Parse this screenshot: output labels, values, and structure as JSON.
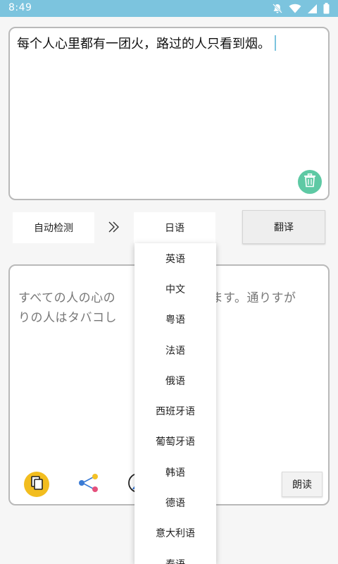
{
  "status": {
    "time": "8:49"
  },
  "input": {
    "text": "每个人心里都有一团火，路过的人只看到烟。"
  },
  "lang_bar": {
    "source_label": "自动检测",
    "target_label": "日语",
    "translate_label": "翻译"
  },
  "output": {
    "text_line1": "すべての人の心の",
    "text_line1_end": "ります。通りすが",
    "text_line2": "りの人はタバコし",
    "read_label": "朗读"
  },
  "dropdown": {
    "options": [
      "英语",
      "中文",
      "粤语",
      "法语",
      "俄语",
      "西班牙语",
      "葡萄牙语",
      "韩语",
      "德语",
      "意大利语",
      "泰语"
    ]
  },
  "colors": {
    "status_bar": "#7cc4de",
    "clear_button": "#5ec9a4",
    "copy_button": "#f2bd1f"
  },
  "icons": [
    "mute-icon",
    "wifi-icon",
    "signal-icon",
    "battery-icon",
    "trash-icon",
    "double-chevron-right-icon",
    "copy-icon",
    "share-icon",
    "user-icon"
  ]
}
